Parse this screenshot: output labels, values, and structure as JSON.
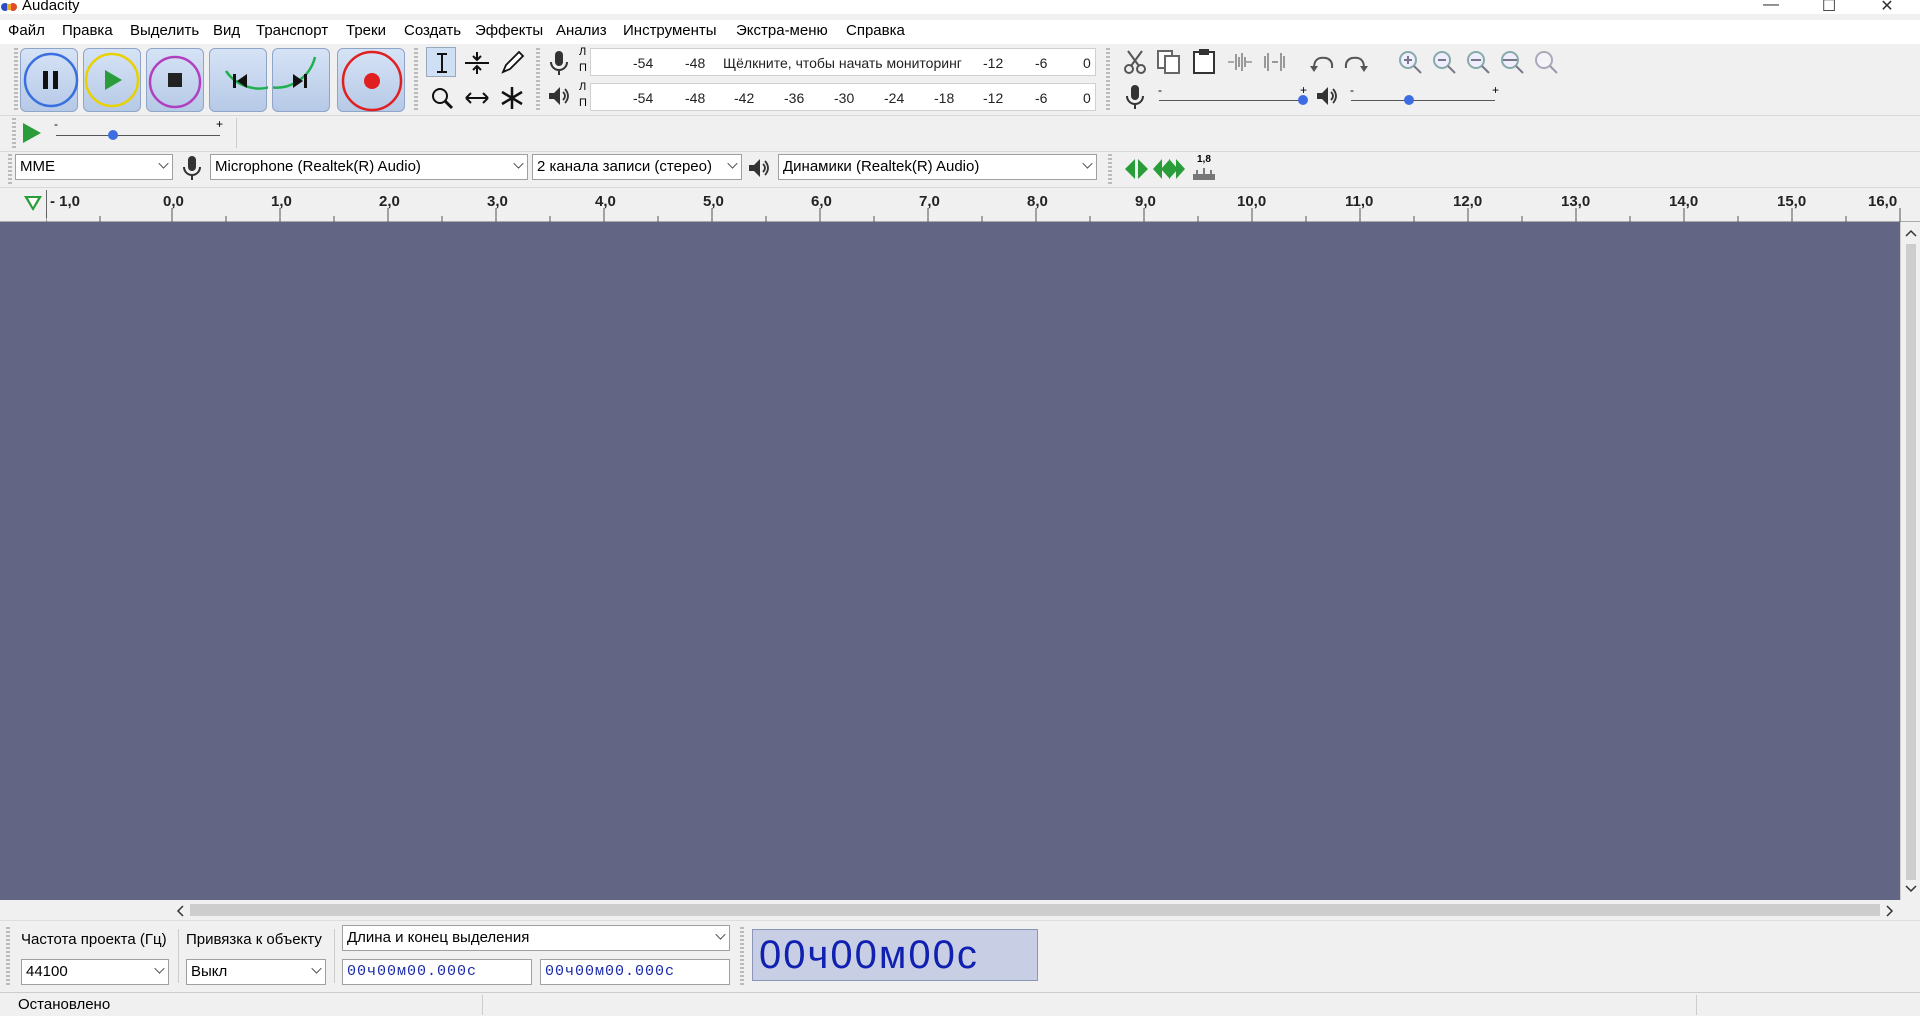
{
  "window": {
    "title": "Audacity",
    "controls": {
      "minimize": "—",
      "maximize": "☐",
      "close": "✕"
    }
  },
  "menubar": [
    "Файл",
    "Правка",
    "Выделить",
    "Вид",
    "Транспорт",
    "Треки",
    "Создать",
    "Эффекты",
    "Анализ",
    "Инструменты",
    "Экстра-меню",
    "Справка"
  ],
  "transport": {
    "buttons": [
      {
        "name": "pause",
        "ring": "#3a6fe0"
      },
      {
        "name": "play",
        "ring": "#e8d100"
      },
      {
        "name": "stop",
        "ring": "#b040c0"
      },
      {
        "name": "skip-start",
        "ring": "#20b050"
      },
      {
        "name": "skip-end",
        "ring": "#20b050"
      },
      {
        "name": "record",
        "ring": "#e02020"
      }
    ]
  },
  "meters": {
    "record_channel_labels": [
      "Л",
      "П"
    ],
    "play_channel_labels": [
      "Л",
      "П"
    ],
    "record_scale": [
      "-54",
      "-48",
      "Щёлкните, чтобы начать мониторинг",
      "-12",
      "-6",
      "0"
    ],
    "play_scale": [
      "-54",
      "-48",
      "-42",
      "-36",
      "-30",
      "-24",
      "-18",
      "-12",
      "-6",
      "0"
    ]
  },
  "mixer": {
    "record_min": "-",
    "record_max": "+",
    "play_min": "-",
    "play_max": "+",
    "record_level": 1.0,
    "play_level": 0.4
  },
  "play_at_speed": {
    "min": "-",
    "max": "+",
    "level": 0.35
  },
  "device": {
    "host": "MME",
    "input": "Microphone (Realtek(R) Audio)",
    "channels": "2 канала записи (стерео)",
    "output": "Динамики (Realtek(R) Audio)",
    "cut_preview_label": "1,8"
  },
  "ruler": {
    "ticks": [
      "- 1,0",
      "0,0",
      "1,0",
      "2,0",
      "3,0",
      "4,0",
      "5,0",
      "6,0",
      "7,0",
      "8,0",
      "9,0",
      "10,0",
      "11,0",
      "12,0",
      "13,0",
      "14,0",
      "15,0",
      "16,0"
    ]
  },
  "selection": {
    "rate_label": "Частота проекта (Гц)",
    "rate_value": "44100",
    "snap_label": "Привязка к объекту",
    "snap_value": "Выкл",
    "mode": "Длина и конец выделения",
    "start_time": "00ч00м00.000с",
    "end_time": "00ч00м00.000с"
  },
  "time_display": "00ч00м00с",
  "status": "Остановлено",
  "colors": {
    "track_bg": "#636584",
    "record": "#e02020",
    "play_green": "#2a9d3a"
  }
}
